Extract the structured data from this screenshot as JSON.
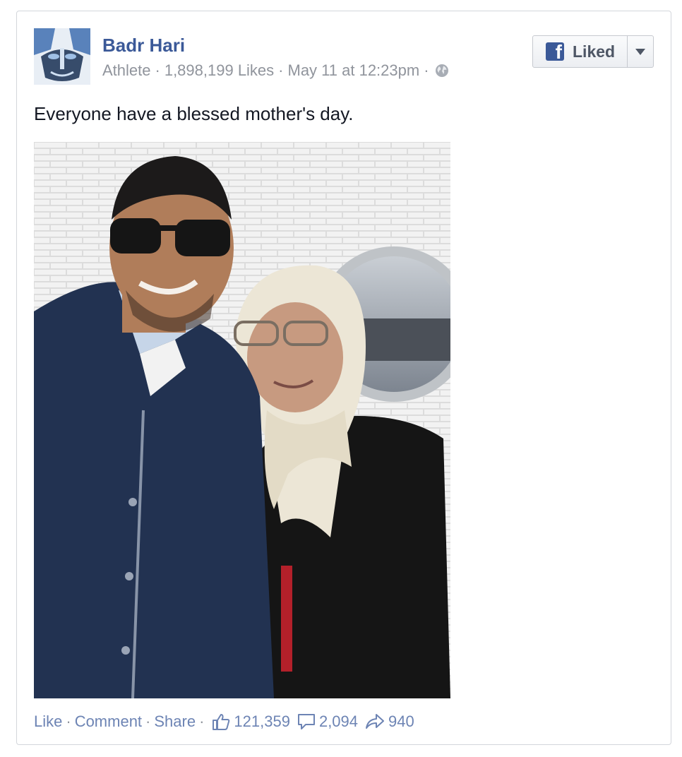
{
  "post": {
    "page_name": "Badr Hari",
    "category": "Athlete",
    "likes": "1,898,199 Likes",
    "timestamp": "May 11 at 12:23pm",
    "audience_icon": "globe-icon",
    "message": "Everyone have a blessed mother's day."
  },
  "like_button": {
    "label": "Liked",
    "icon": "facebook-f-icon",
    "caret_icon": "caret-down-icon"
  },
  "actions": {
    "like": "Like",
    "comment": "Comment",
    "share": "Share",
    "like_count": "121,359",
    "comment_count": "2,094",
    "share_count": "940"
  },
  "colors": {
    "brand": "#3b5998",
    "link": "#6d84b4",
    "meta": "#90949c",
    "text": "#141823"
  }
}
